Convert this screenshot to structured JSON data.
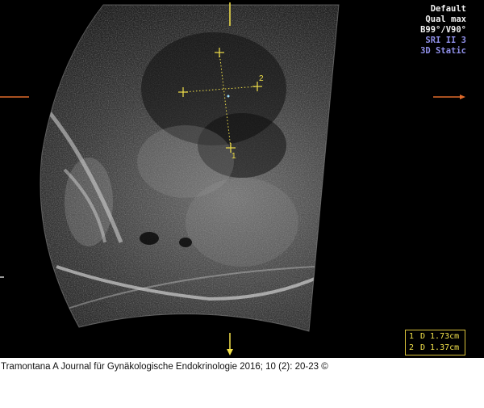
{
  "info_lines": [
    {
      "text": "Default",
      "color": "#f0f0f0"
    },
    {
      "text": "Qual max",
      "color": "#f0f0f0"
    },
    {
      "text": "B99°/V90°",
      "color": "#f0f0f0"
    },
    {
      "text": "SRI II 3",
      "color": "#8f8fe8"
    },
    {
      "text": "3D Static",
      "color": "#8f8fe8"
    }
  ],
  "measurements": [
    {
      "index": "1",
      "value": "D 1.73cm"
    },
    {
      "index": "2",
      "value": "D 1.37cm"
    }
  ],
  "caliper_labels": {
    "first": "1",
    "second": "2"
  },
  "caption": "Tramontana A Journal für Gynäkologische Endokrinologie 2016; 10 (2): 20-23 ©",
  "colors": {
    "caliper": "#f2e14a",
    "marker": "#e06a2a",
    "background": "#000000"
  }
}
